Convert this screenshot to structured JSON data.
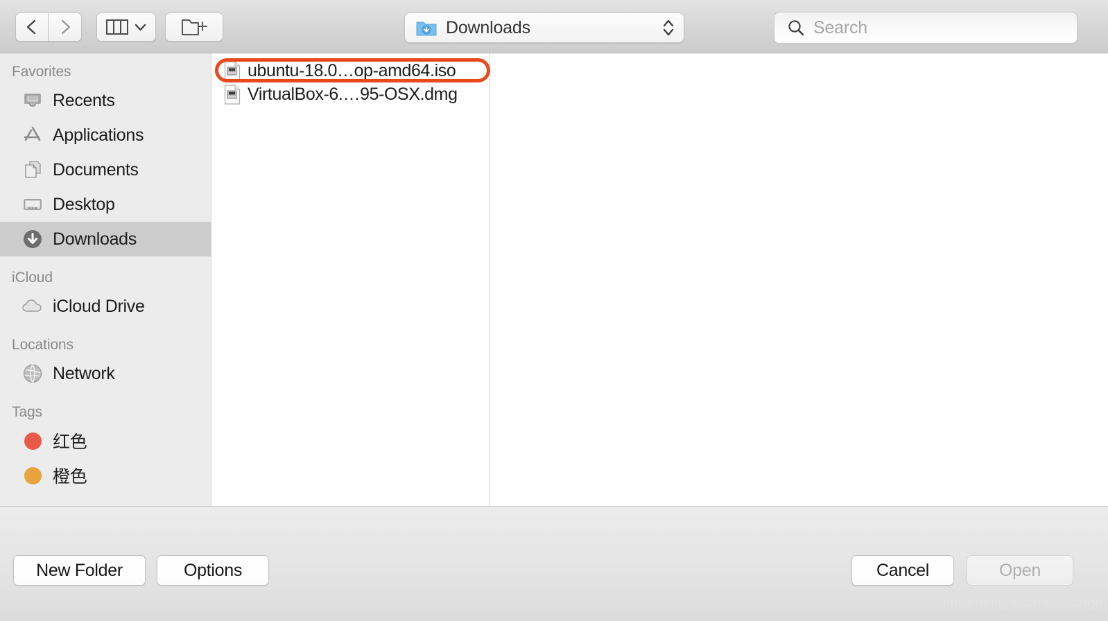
{
  "toolbar": {
    "back_icon": "chevron-left-icon",
    "forward_icon": "chevron-right-icon",
    "view_mode_icon": "column-view-icon",
    "view_mode_chevron": "chevron-down-icon",
    "new_folder_icon": "new-folder-icon",
    "path_popup": {
      "icon": "downloads-folder-icon",
      "label": "Downloads",
      "stepper_icon": "up-down-chevron-icon"
    },
    "search": {
      "icon": "search-icon",
      "placeholder": "Search",
      "value": ""
    }
  },
  "sidebar": {
    "sections": [
      {
        "header": "Favorites",
        "items": [
          {
            "label": "Recents",
            "icon": "recents-icon",
            "selected": false
          },
          {
            "label": "Applications",
            "icon": "applications-icon",
            "selected": false
          },
          {
            "label": "Documents",
            "icon": "documents-icon",
            "selected": false
          },
          {
            "label": "Desktop",
            "icon": "desktop-icon",
            "selected": false
          },
          {
            "label": "Downloads",
            "icon": "downloads-icon",
            "selected": true
          }
        ]
      },
      {
        "header": "iCloud",
        "items": [
          {
            "label": "iCloud Drive",
            "icon": "cloud-icon",
            "selected": false
          }
        ]
      },
      {
        "header": "Locations",
        "items": [
          {
            "label": "Network",
            "icon": "network-globe-icon",
            "selected": false
          }
        ]
      },
      {
        "header": "Tags",
        "items": [
          {
            "label": "红色",
            "icon": "tag-dot-icon",
            "color": "#e8594a",
            "selected": false
          },
          {
            "label": "橙色",
            "icon": "tag-dot-icon",
            "color": "#e8a33d",
            "selected": false
          }
        ]
      }
    ]
  },
  "file_list": {
    "files": [
      {
        "name": "ubuntu-18.0…op-amd64.iso",
        "icon": "disk-image-icon",
        "highlighted": true
      },
      {
        "name": "VirtualBox-6.…95-OSX.dmg",
        "icon": "disk-image-icon",
        "highlighted": false
      }
    ]
  },
  "annotation": {
    "color": "#e8491e",
    "target": "ubuntu-18.0…op-amd64.iso"
  },
  "footer": {
    "new_folder_label": "New Folder",
    "options_label": "Options",
    "cancel_label": "Cancel",
    "open_label": "Open",
    "open_disabled": true
  },
  "watermark": {
    "text": "https://blog.csdn.net/wzfgd"
  }
}
